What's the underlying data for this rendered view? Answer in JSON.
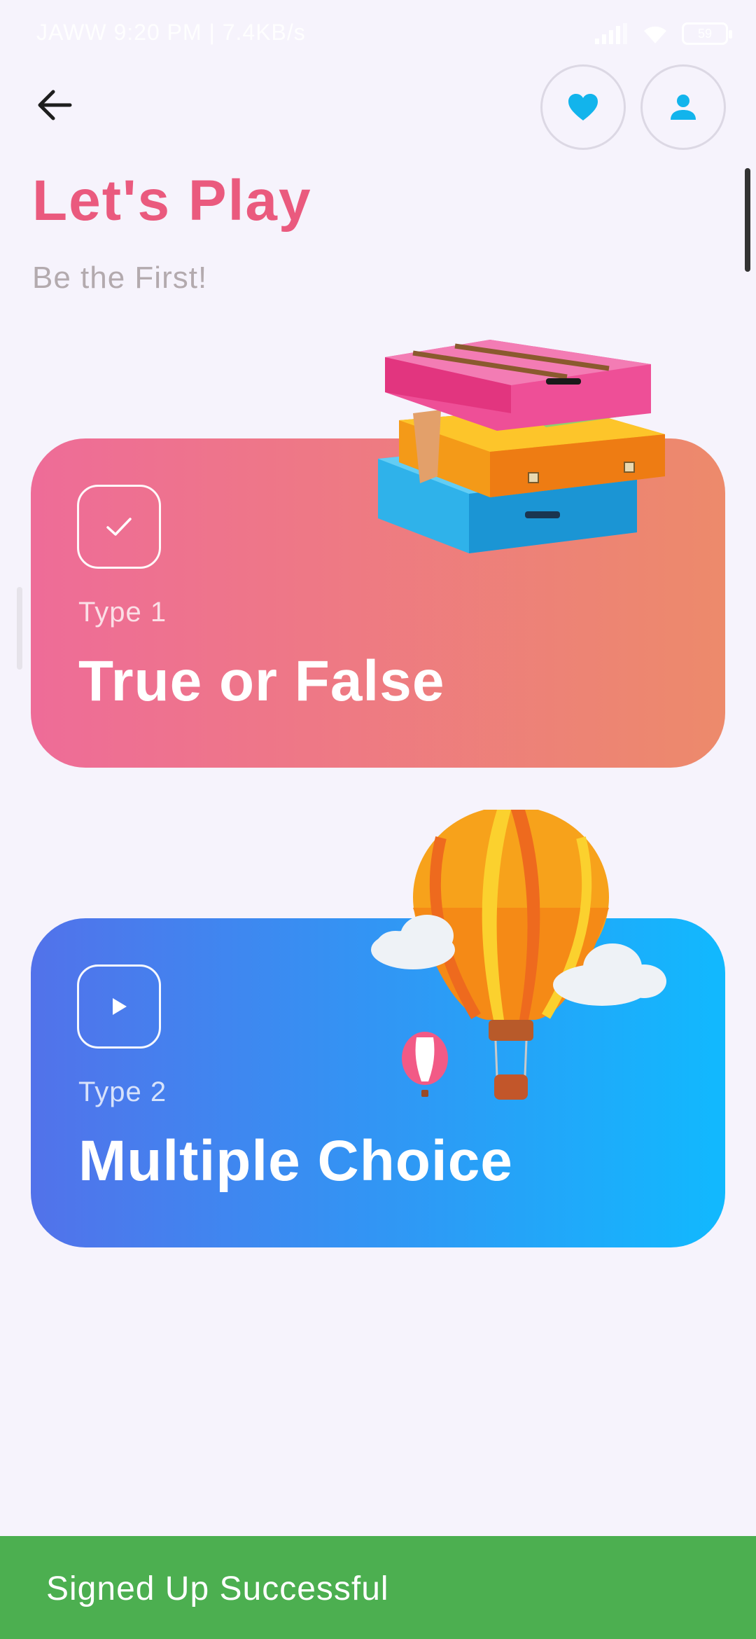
{
  "status_bar": {
    "left_text": "JAWW  9:20 PM | 7.4KB/s",
    "battery": "59"
  },
  "header": {
    "back_icon": "arrow-left-icon",
    "favorite_icon": "heart-icon",
    "profile_icon": "person-icon"
  },
  "page": {
    "title": "Let's Play",
    "subtitle": "Be the First!"
  },
  "cards": [
    {
      "type_label": "Type 1",
      "title": "True or False",
      "icon": "check-icon",
      "illustration": "suitcases"
    },
    {
      "type_label": "Type 2",
      "title": "Multiple Choice",
      "icon": "play-icon",
      "illustration": "hot-air-balloon"
    }
  ],
  "snackbar": {
    "message": "Signed Up Successful"
  },
  "colors": {
    "background": "#f6f3fc",
    "title": "#ea5a7e",
    "accent_blue": "#11b9fe",
    "snackbar": "#4caf50"
  }
}
